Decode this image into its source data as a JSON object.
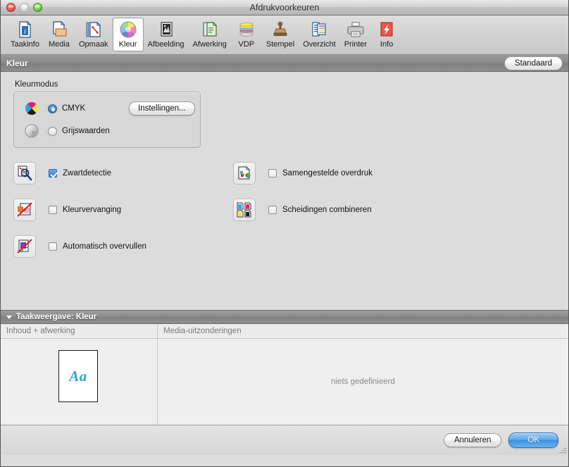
{
  "window": {
    "title": "Afdrukvoorkeuren",
    "controls": [
      {
        "name": "close",
        "color": "#e0463c",
        "enabled": true
      },
      {
        "name": "minimize",
        "color": "#d6d6d6",
        "enabled": false
      },
      {
        "name": "zoom",
        "color": "#5bbd39",
        "enabled": true
      }
    ]
  },
  "toolbar": {
    "selected": "Kleur",
    "items": [
      {
        "label": "Taakinfo",
        "icon": "job-info-icon"
      },
      {
        "label": "Media",
        "icon": "media-icon"
      },
      {
        "label": "Opmaak",
        "icon": "layout-icon"
      },
      {
        "label": "Kleur",
        "icon": "color-wheel-icon"
      },
      {
        "label": "Afbeelding",
        "icon": "image-icon"
      },
      {
        "label": "Afwerking",
        "icon": "finishing-icon"
      },
      {
        "label": "VDP",
        "icon": "vdp-stack-icon"
      },
      {
        "label": "Stempel",
        "icon": "stamp-icon"
      },
      {
        "label": "Overzicht",
        "icon": "summary-icon"
      },
      {
        "label": "Printer",
        "icon": "printer-icon"
      },
      {
        "label": "Info",
        "icon": "info-red-icon"
      }
    ]
  },
  "section": {
    "title": "Kleur",
    "default_button": "Standaard"
  },
  "color_mode": {
    "group_label": "Kleurmodus",
    "settings_button": "Instellingen...",
    "selected": "CMYK",
    "options": [
      {
        "label": "CMYK",
        "checked": true,
        "icon": "cmyk-wheel-icon"
      },
      {
        "label": "Grijswaarden",
        "checked": false,
        "icon": "grayscale-wheel-icon"
      }
    ]
  },
  "options_left": [
    {
      "label": "Zwartdetectie",
      "checked": true,
      "icon": "black-detection-icon"
    },
    {
      "label": "Kleurvervanging",
      "checked": false,
      "icon": "color-substitution-icon"
    },
    {
      "label": "Automatisch overvullen",
      "checked": false,
      "icon": "auto-trapping-icon"
    }
  ],
  "options_right": [
    {
      "label": "Samengestelde overdruk",
      "checked": false,
      "icon": "composite-overprint-icon"
    },
    {
      "label": "Scheidingen combineren",
      "checked": false,
      "icon": "combine-separations-icon"
    }
  ],
  "job_view": {
    "title": "Taakweergave: Kleur",
    "columns": [
      "Inhoud + afwerking",
      "Media-uitzonderingen"
    ],
    "preview_text": "Aa",
    "empty_text": "niets gedefinieerd"
  },
  "footer": {
    "cancel": "Annuleren",
    "ok": "OK"
  },
  "colors": {
    "window_bg": "#dcdcdc",
    "panel_bg": "#efefef",
    "accent_blue": "#3d90e0",
    "header_gray": "#8b8b8b",
    "preview_text": "#2ba6d8"
  }
}
